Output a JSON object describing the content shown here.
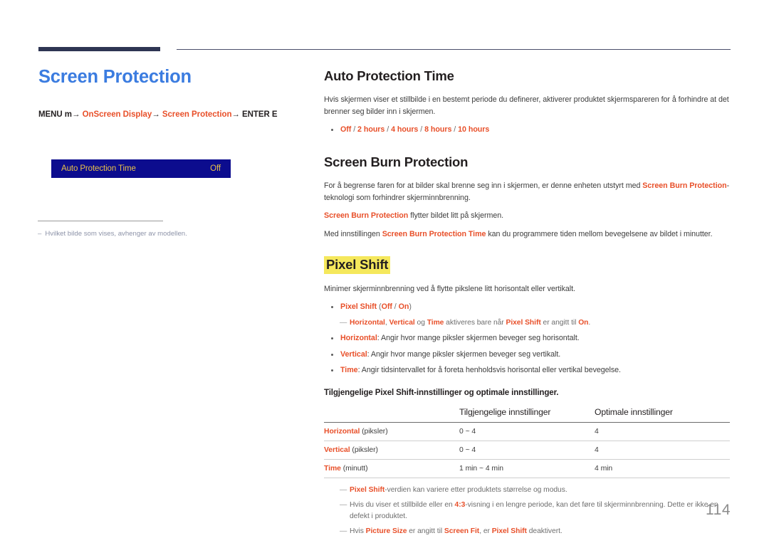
{
  "page": {
    "number": "114"
  },
  "left": {
    "chapter_title": "Screen Protection",
    "menu_path": {
      "start": "MENU m",
      "arrow": "→",
      "item1": "OnScreen Display",
      "item2": "Screen Protection",
      "end": "ENTER E"
    },
    "osd": {
      "label": "Auto Protection Time",
      "value": "Off"
    },
    "note": {
      "dash": "–",
      "text": "Hvilket bilde som vises, avhenger av modellen."
    }
  },
  "sections": {
    "auto_protection": {
      "title": "Auto Protection Time",
      "paragraph": "Hvis skjermen viser et stillbilde i en bestemt periode du definerer, aktiverer produktet skjermspareren for å forhindre at det brenner seg bilder inn i skjermen.",
      "options": [
        "Off",
        "2 hours",
        "4 hours",
        "8 hours",
        "10 hours"
      ],
      "separator": "/"
    },
    "screen_burn": {
      "title": "Screen Burn Protection",
      "p1_a": "For å begrense faren for at bilder skal brenne seg inn i skjermen, er denne enheten utstyrt med ",
      "p1_term": "Screen Burn Protection",
      "p1_b": "-teknologi som forhindrer skjerminnbrenning.",
      "p2_term": "Screen Burn Protection",
      "p2_b": " flytter bildet litt på skjermen.",
      "p3_a": "Med innstillingen ",
      "p3_term": "Screen Burn Protection Time",
      "p3_b": " kan du programmere tiden mellom bevegelsene av bildet i minutter."
    },
    "pixel_shift": {
      "title": "Pixel Shift",
      "paragraph": "Minimer skjerminnbrenning ved å flytte pikslene litt horisontalt eller vertikalt.",
      "bullet_main": {
        "term": "Pixel Shift",
        "values": "(Off / On)",
        "off": "Off",
        "on": "On",
        "slash": " / ",
        "open": "(",
        "close": ")"
      },
      "subnote": {
        "dash": "—",
        "t1": "Horizontal",
        "sep1": ", ",
        "t2": "Vertical",
        "sep2": " og ",
        "t3": "Time",
        "mid": " aktiveres bare når ",
        "t4": "Pixel Shift",
        "mid2": " er angitt til ",
        "t5": "On",
        "end": "."
      },
      "bullets": [
        {
          "term": "Horizontal",
          "text": ": Angir hvor mange piksler skjermen beveger seg horisontalt."
        },
        {
          "term": "Vertical",
          "text": ": Angir hvor mange piksler skjermen beveger seg vertikalt."
        },
        {
          "term": "Time",
          "text": ": Angir tidsintervallet for å foreta henholdsvis horisontal eller vertikal bevegelse."
        }
      ],
      "table_intro": "Tilgjengelige Pixel Shift-innstillinger og optimale innstillinger.",
      "table": {
        "headers": [
          "",
          "Tilgjengelige innstillinger",
          "Optimale innstillinger"
        ],
        "rows": [
          {
            "term": "Horizontal",
            "unit": " (piksler)",
            "available": "0 ~ 4",
            "optimal": "4"
          },
          {
            "term": "Vertical",
            "unit": " (piksler)",
            "available": "0 ~ 4",
            "optimal": "4"
          },
          {
            "term": "Time",
            "unit": " (minutt)",
            "available": "1 min ~ 4 min",
            "optimal": "4 min"
          }
        ]
      },
      "footnotes": [
        {
          "dash": "—",
          "term": "Pixel Shift",
          "text": "-verdien kan variere etter produktets størrelse og modus."
        },
        {
          "dash": "—",
          "pre": "Hvis du viser et stillbilde eller en ",
          "term": "4:3",
          "text": "-visning i en lengre periode, kan det føre til skjerminnbrenning. Dette er ikke en defekt i produktet."
        },
        {
          "dash": "—",
          "pre": "Hvis ",
          "term": "Picture Size",
          "mid": " er angitt til ",
          "term2": "Screen Fit",
          "mid2": ", er ",
          "term3": "Pixel Shift",
          "text": " deaktivert."
        }
      ]
    }
  },
  "colors": {
    "accent_red": "#e8502a",
    "title_blue": "#3b7ce0",
    "rule_navy": "#2e3553",
    "osd_bg": "#0c0c8e",
    "osd_text": "#e8c14a",
    "highlight_yellow": "#f5e85c"
  }
}
